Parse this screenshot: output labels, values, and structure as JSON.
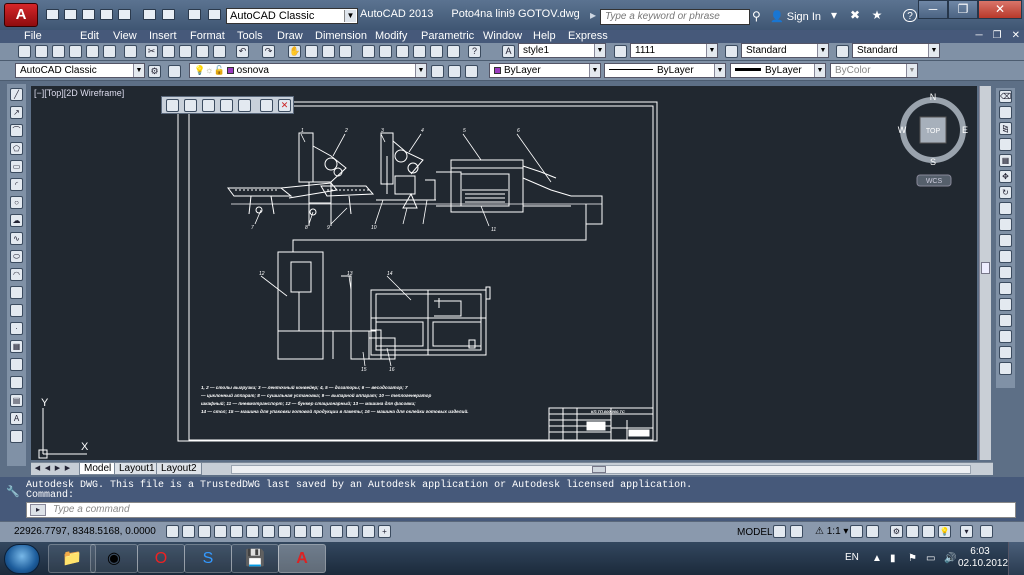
{
  "titlebar": {
    "logo": "A",
    "workspace": "AutoCAD Classic",
    "app_name": "AutoCAD 2013",
    "file_name": "Poto4na lini9 GOTOV.dwg",
    "search_placeholder": "Type a keyword or phrase",
    "sign_in": "Sign In"
  },
  "menu": [
    "File",
    "Edit",
    "View",
    "Insert",
    "Format",
    "Tools",
    "Draw",
    "Dimension",
    "Modify",
    "Parametric",
    "Window",
    "Help",
    "Express"
  ],
  "toolbar_styles": {
    "text_style": "style1",
    "dim_style": "1111",
    "table_style": "Standard",
    "multileader_style": "Standard"
  },
  "toolbar_layers": {
    "workspace": "AutoCAD Classic",
    "layer": "osnova",
    "color": "ByLayer",
    "linetype": "ByLayer",
    "lineweight": "ByLayer",
    "plotstyle": "ByColor",
    "layer_color": "#9b3bbf",
    "color_swatch": "#9b3bbf"
  },
  "viewport": {
    "label": "[−][Top][2D Wireframe]",
    "viewcube": {
      "top": "TOP",
      "n": "N",
      "s": "S",
      "e": "E",
      "w": "W",
      "ucs": "WCS"
    },
    "ucs_icon": {
      "x": "X",
      "y": "Y"
    }
  },
  "drawing": {
    "callouts_top": [
      "1",
      "2",
      "3",
      "4",
      "5",
      "6",
      "7",
      "8",
      "9",
      "10",
      "11"
    ],
    "callouts_bottom": [
      "12",
      "13",
      "14",
      "15",
      "16"
    ],
    "notes_line1": "1, 2 — столы выгрузки; 3 — ленточный конвейер; 4, 5 — дозаторы; 6 — весодозатор;                     7",
    "notes_line2": "— циклонный аппарат; 8 — сушильная установка; 9 — выпарной аппарат; 10 — теплогенератор",
    "notes_line3": "шкафный; 11 — пневмотранспорт; 12 — бункер стационарный; 13 — машина для фасовки;",
    "notes_line4": "14 — стол; 15 — машина для упаковки готовой продукции в пакеты; 16 — машина для оклейки готовых изделий.",
    "title_block_code": "КП.ТП.000.000.ТС"
  },
  "tabs": {
    "model": "Model",
    "layout1": "Layout1",
    "layout2": "Layout2"
  },
  "command": {
    "history": "Autodesk DWG.  This file is a TrustedDWG last saved by an Autodesk application or Autodesk licensed application.",
    "prompt": "Command:",
    "placeholder": "Type a command"
  },
  "status": {
    "coords": "22926.7797, 8348.5168, 0.0000",
    "space": "MODEL",
    "scale": "1:1"
  },
  "taskbar": {
    "language": "EN",
    "time": "6:03",
    "date": "02.10.2012"
  }
}
